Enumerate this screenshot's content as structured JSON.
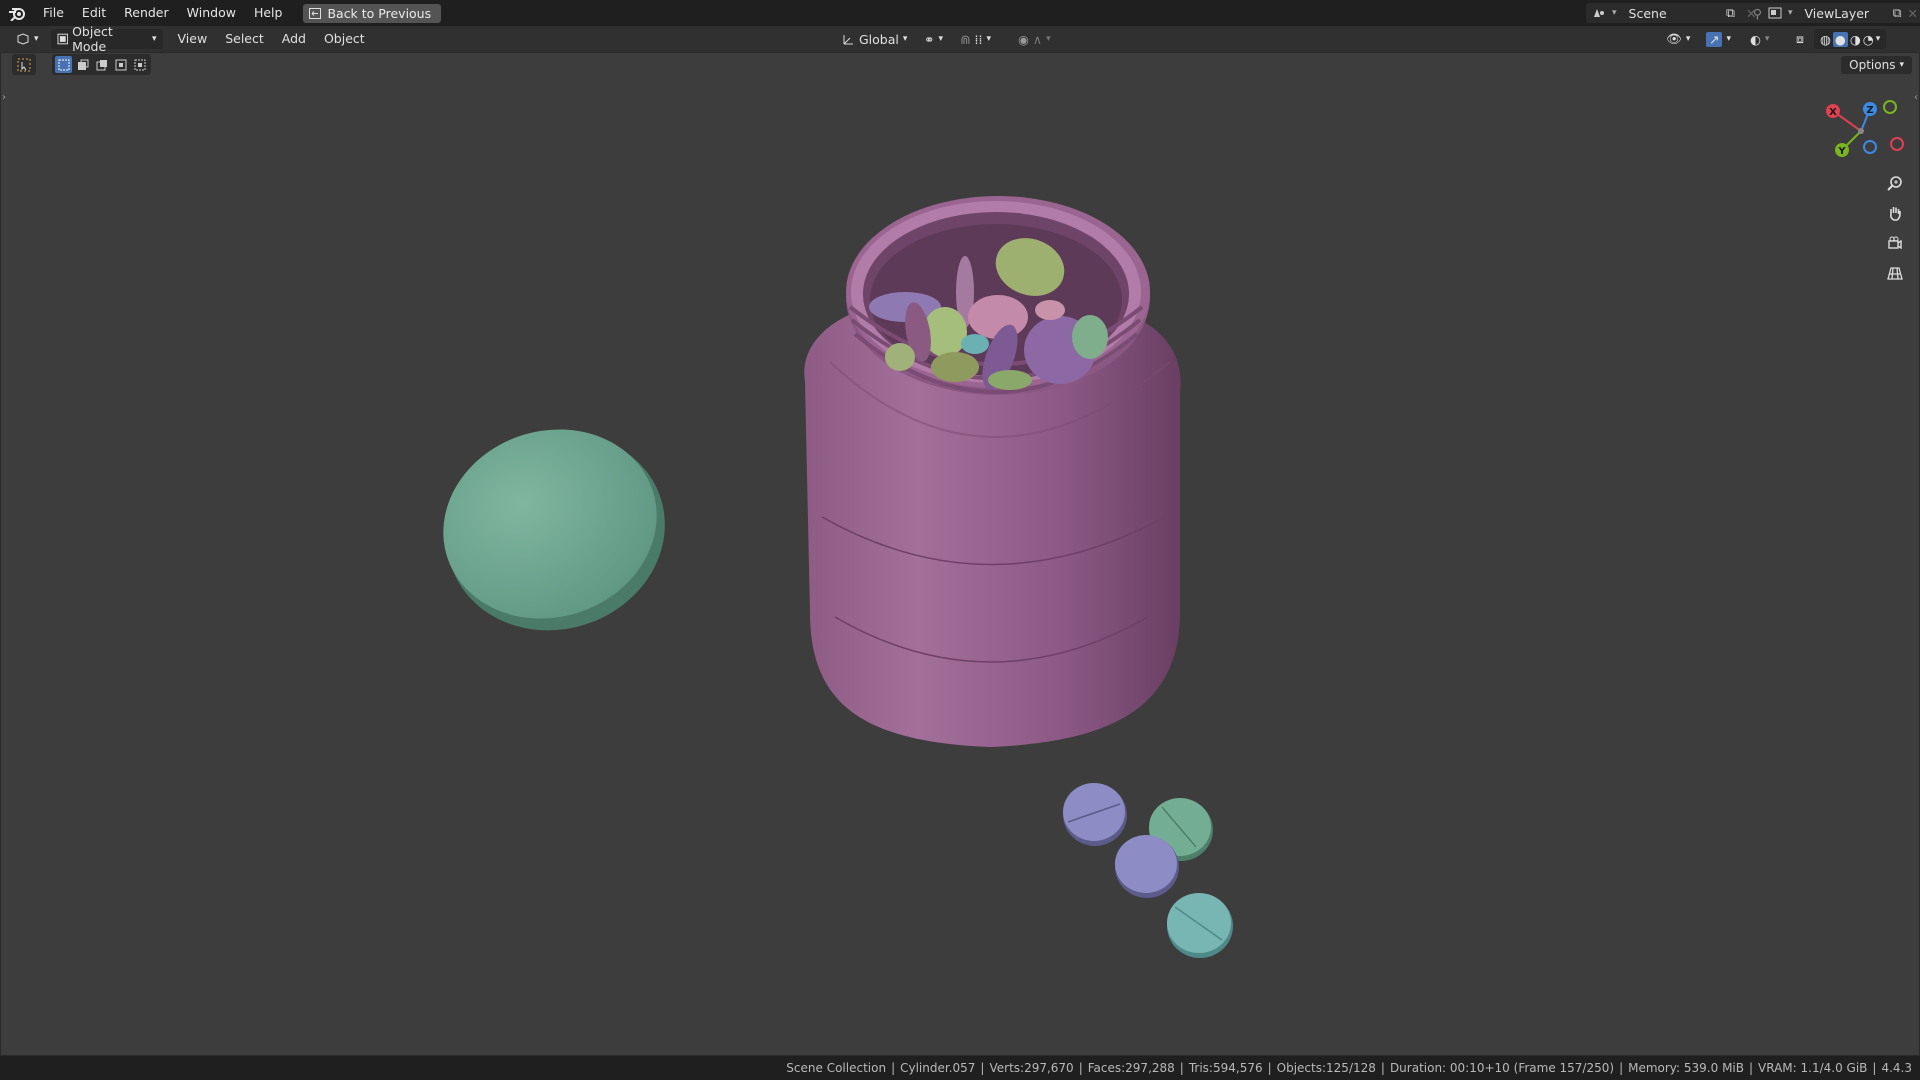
{
  "topbar": {
    "menus": [
      "File",
      "Edit",
      "Render",
      "Window",
      "Help"
    ],
    "back_button": "Back to Previous",
    "scene_name": "Scene",
    "view_layer": "ViewLayer"
  },
  "header": {
    "mode": "Object Mode",
    "menus": [
      "View",
      "Select",
      "Add",
      "Object"
    ],
    "transform_orientation": "Global",
    "options_label": "Options"
  },
  "gizmo": {
    "x_label": "X",
    "y_label": "Y",
    "z_label": "Z",
    "x_color": "#e04050",
    "y_color": "#7ab41e",
    "z_color": "#3b8ae6"
  },
  "statusbar": {
    "collection": "Scene Collection",
    "object": "Cylinder.057",
    "verts": "Verts:297,670",
    "faces": "Faces:297,288",
    "tris": "Tris:594,576",
    "objects": "Objects:125/128",
    "duration": "Duration: 00:10+10 (Frame 157/250)",
    "memory": "Memory: 539.0 MiB",
    "vram": "VRAM: 1.1/4.0 GiB",
    "version": "4.4.3"
  },
  "colors": {
    "jar": "#9a6590",
    "cap": "#6fa58f",
    "accent": "#4772b3"
  }
}
